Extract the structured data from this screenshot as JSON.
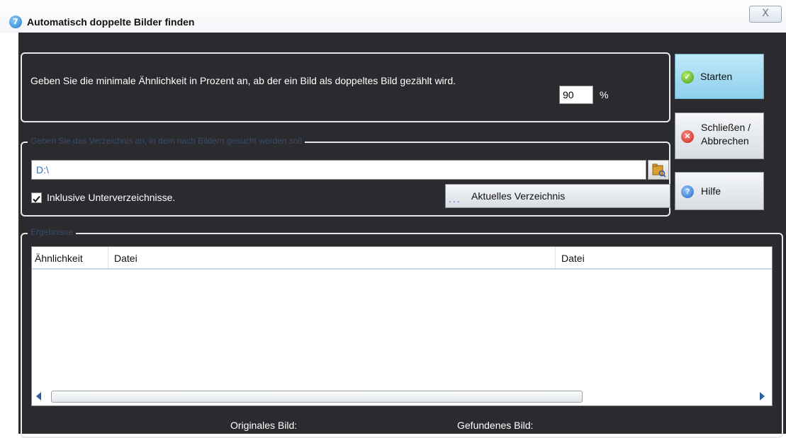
{
  "window": {
    "title": "Automatisch doppelte Bilder finden",
    "app_icon_glyph": "7",
    "close_glyph": "X"
  },
  "similarity": {
    "prompt": "Geben Sie die minimale Ähnlichkeit in Prozent an, ab der ein Bild als doppeltes Bild gezählt wird.",
    "value": "90",
    "unit": "%"
  },
  "directory": {
    "legend": "Geben Sie das Verzeichnis an, in dem nach Bildern gesucht werden soll",
    "path": "D:\\",
    "include_subdirs_label": "Inklusive Unterverzeichnisse.",
    "include_subdirs_checked": true,
    "current_dir_button": "Aktuelles Verzeichnis",
    "current_dir_dots": "..."
  },
  "buttons": {
    "start": "Starten",
    "close_line1": "Schließen /",
    "close_line2": "Abbrechen",
    "help": "Hilfe"
  },
  "results": {
    "legend": "Ergebnisse",
    "columns": [
      "Ähnlichkeit",
      "Datei",
      "Datei"
    ],
    "rows": [],
    "original_label": "Originales Bild:",
    "found_label": "Gefundenes Bild:"
  },
  "colors": {
    "background_dark": "#2b2b2f",
    "start_button": "#9fdaf0",
    "accent_blue": "#3b6fc4"
  },
  "icons": [
    "app-icon",
    "close-icon",
    "folder-icon",
    "check-icon",
    "cancel-icon",
    "help-icon",
    "scroll-left-arrow-icon",
    "scroll-right-arrow-icon"
  ]
}
